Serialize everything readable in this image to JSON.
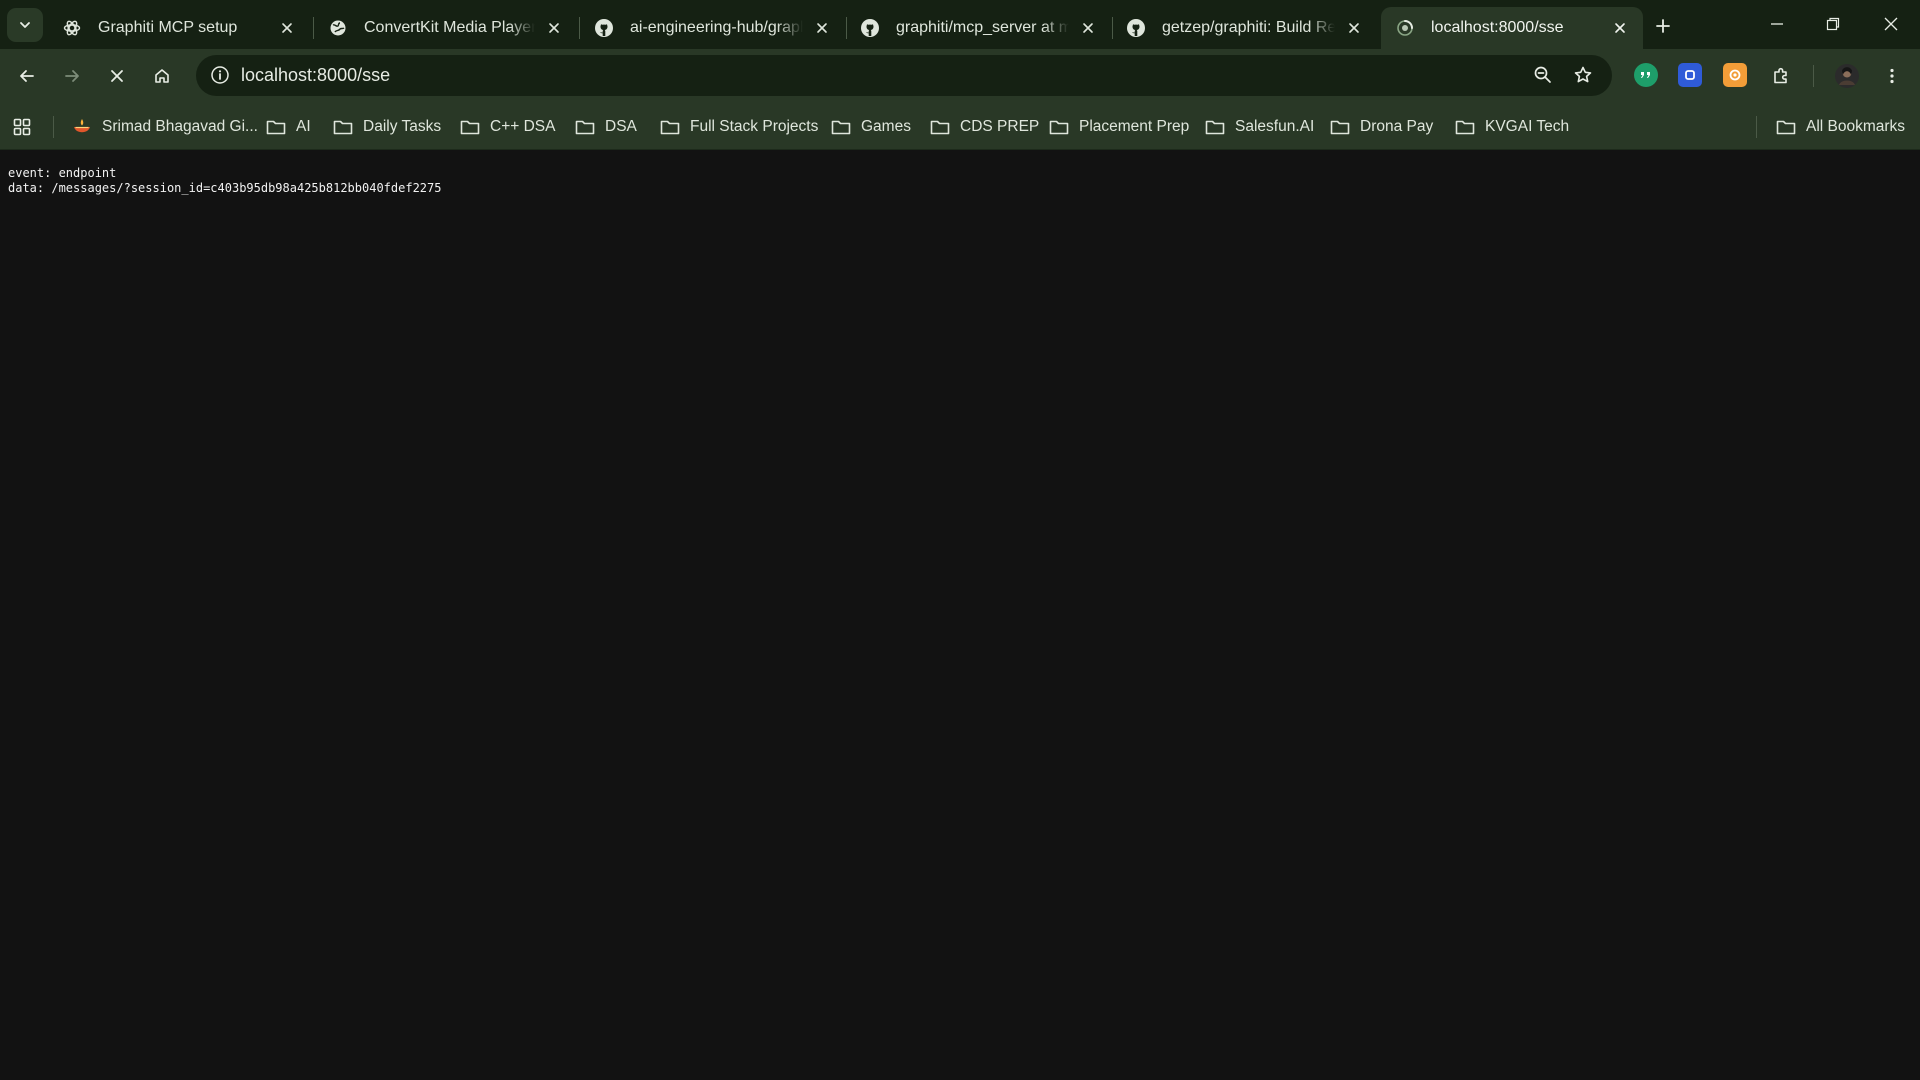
{
  "colors": {
    "frame": "#152113",
    "toolbar": "#293826",
    "page_background": "#121212",
    "text": "#e3e3e3",
    "ext_green": "#1e9e6a",
    "ext_blue": "#2f5bd8",
    "ext_orange": "#f29d38"
  },
  "tabs": [
    {
      "title": "Graphiti MCP setup",
      "icon": "openai-icon",
      "active": false
    },
    {
      "title": "ConvertKit Media Player",
      "icon": "globe-icon",
      "active": false
    },
    {
      "title": "ai-engineering-hub/graphiti",
      "icon": "github-icon",
      "active": false
    },
    {
      "title": "graphiti/mcp_server at main",
      "icon": "github-icon",
      "active": false
    },
    {
      "title": "getzep/graphiti: Build Real-Time",
      "icon": "github-icon",
      "active": false
    },
    {
      "title": "localhost:8000/sse",
      "icon": "loading-globe-icon",
      "active": true
    }
  ],
  "address_bar": {
    "url": "localhost:8000/sse"
  },
  "bookmarks": [
    {
      "label": "Srimad Bhagavad Gi...",
      "icon": "diya-icon"
    },
    {
      "label": "AI",
      "icon": "folder-icon"
    },
    {
      "label": "Daily Tasks",
      "icon": "folder-icon"
    },
    {
      "label": "C++ DSA",
      "icon": "folder-icon"
    },
    {
      "label": "DSA",
      "icon": "folder-icon"
    },
    {
      "label": "Full Stack Projects",
      "icon": "folder-icon"
    },
    {
      "label": "Games",
      "icon": "folder-icon"
    },
    {
      "label": "CDS PREP",
      "icon": "folder-icon"
    },
    {
      "label": "Placement Prep",
      "icon": "folder-icon"
    },
    {
      "label": "Salesfun.AI",
      "icon": "folder-icon"
    },
    {
      "label": "Drona Pay",
      "icon": "folder-icon"
    },
    {
      "label": "KVGAI Tech",
      "icon": "folder-icon"
    }
  ],
  "all_bookmarks_label": "All Bookmarks",
  "page": {
    "line1": "event: endpoint",
    "line2": "data: /messages/?session_id=c403b95db98a425b812bb040fdef2275"
  }
}
